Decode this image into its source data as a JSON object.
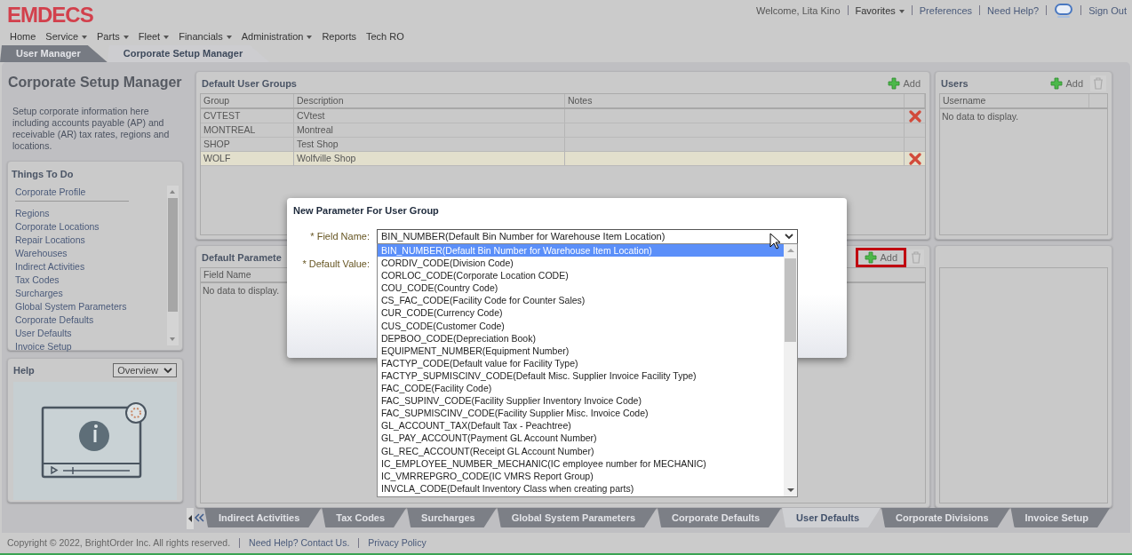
{
  "header": {
    "logo": "EMDECS",
    "welcome": "Welcome, Lita Kino",
    "favorites": "Favorites",
    "links": [
      "Preferences",
      "Need Help?"
    ],
    "sign_out": "Sign Out"
  },
  "nav": [
    {
      "label": "Home",
      "dropdown": false
    },
    {
      "label": "Service",
      "dropdown": true
    },
    {
      "label": "Parts",
      "dropdown": true
    },
    {
      "label": "Fleet",
      "dropdown": true
    },
    {
      "label": "Financials",
      "dropdown": true
    },
    {
      "label": "Administration",
      "dropdown": true
    },
    {
      "label": "Reports",
      "dropdown": false
    },
    {
      "label": "Tech RO",
      "dropdown": false
    }
  ],
  "top_tabs": [
    {
      "label": "User Manager",
      "selected": false
    },
    {
      "label": "Corporate Setup Manager",
      "selected": true
    }
  ],
  "sidebar": {
    "title": "Corporate Setup Manager",
    "description": "Setup corporate information here including accounts payable (AP) and receivable (AR) tax rates, regions and locations.",
    "things_to_do": {
      "title": "Things To Do",
      "items": [
        "Corporate Profile",
        "Regions",
        "Corporate Locations",
        "Repair Locations",
        "Warehouses",
        "Indirect Activities",
        "Tax Codes",
        "Surcharges",
        "Global System Parameters",
        "Corporate Defaults",
        "User Defaults",
        "Invoice Setup"
      ]
    },
    "help": {
      "title": "Help",
      "select": "Overview"
    }
  },
  "user_groups": {
    "title": "Default User Groups",
    "add": "Add",
    "columns": [
      "Group",
      "Description",
      "Notes"
    ],
    "rows": [
      {
        "group": "CVTEST",
        "description": "CVtest",
        "deletable": true,
        "selected": false
      },
      {
        "group": "MONTREAL",
        "description": "Montreal",
        "deletable": false,
        "selected": false
      },
      {
        "group": "SHOP",
        "description": "Test Shop",
        "deletable": false,
        "selected": false
      },
      {
        "group": "WOLF",
        "description": "Wolfville Shop",
        "deletable": true,
        "selected": true
      }
    ]
  },
  "parameters": {
    "title": "Default Paramete",
    "add": "Add",
    "add_highlighted": true,
    "columns": [
      "Field Name"
    ],
    "empty": "No data to display."
  },
  "users": {
    "title": "Users",
    "add": "Add",
    "columns": [
      "Username"
    ],
    "empty": "No data to display."
  },
  "bottom_tabs": [
    {
      "label": "Indirect Activities",
      "selected": false
    },
    {
      "label": "Tax Codes",
      "selected": false
    },
    {
      "label": "Surcharges",
      "selected": false
    },
    {
      "label": "Global System Parameters",
      "selected": false
    },
    {
      "label": "Corporate Defaults",
      "selected": false
    },
    {
      "label": "User Defaults",
      "selected": true
    },
    {
      "label": "Corporate Divisions",
      "selected": false
    },
    {
      "label": "Invoice Setup",
      "selected": false
    }
  ],
  "footer": {
    "copyright": "Copyright © 2022, BrightOrder Inc. All rights reserved.",
    "links": [
      "Need Help? Contact Us.",
      "Privacy Policy"
    ]
  },
  "modal": {
    "title": "New Parameter For User Group",
    "fields": [
      {
        "label": "* Field Name:",
        "kind": "select",
        "value": "BIN_NUMBER(Default Bin Number for Warehouse Item Location)"
      },
      {
        "label": "* Default Value:"
      }
    ],
    "options": [
      {
        "label": "BIN_NUMBER(Default Bin Number for Warehouse Item Location)",
        "selected": true
      },
      {
        "label": "CORDIV_CODE(Division Code)",
        "selected": false
      },
      {
        "label": "CORLOC_CODE(Corporate Location CODE)",
        "selected": false
      },
      {
        "label": "COU_CODE(Country Code)",
        "selected": false
      },
      {
        "label": "CS_FAC_CODE(Facility Code for Counter Sales)",
        "selected": false
      },
      {
        "label": "CUR_CODE(Currency Code)",
        "selected": false
      },
      {
        "label": "CUS_CODE(Customer Code)",
        "selected": false
      },
      {
        "label": "DEPBOO_CODE(Depreciation Book)",
        "selected": false
      },
      {
        "label": "EQUIPMENT_NUMBER(Equipment Number)",
        "selected": false
      },
      {
        "label": "FACTYP_CODE(Default value for Facility Type)",
        "selected": false
      },
      {
        "label": "FACTYP_SUPMISCINV_CODE(Default Misc. Supplier Invoice Facility Type)",
        "selected": false
      },
      {
        "label": "FAC_CODE(Facility Code)",
        "selected": false
      },
      {
        "label": "FAC_SUPINV_CODE(Facility Supplier Inventory Invoice Code)",
        "selected": false
      },
      {
        "label": "FAC_SUPMISCINV_CODE(Facility Supplier Misc. Invoice Code)",
        "selected": false
      },
      {
        "label": "GL_ACCOUNT_TAX(Default Tax - Peachtree)",
        "selected": false
      },
      {
        "label": "GL_PAY_ACCOUNT(Payment GL Account Number)",
        "selected": false
      },
      {
        "label": "GL_REC_ACCOUNT(Receipt GL Account Number)",
        "selected": false
      },
      {
        "label": "IC_EMPLOYEE_NUMBER_MECHANIC(IC employee number for MECHANIC)",
        "selected": false
      },
      {
        "label": "IC_VMRREPGRO_CODE(IC VMRS Report Group)",
        "selected": false
      },
      {
        "label": "INVCLA_CODE(Default Inventory Class when creating parts)",
        "selected": false
      }
    ]
  }
}
